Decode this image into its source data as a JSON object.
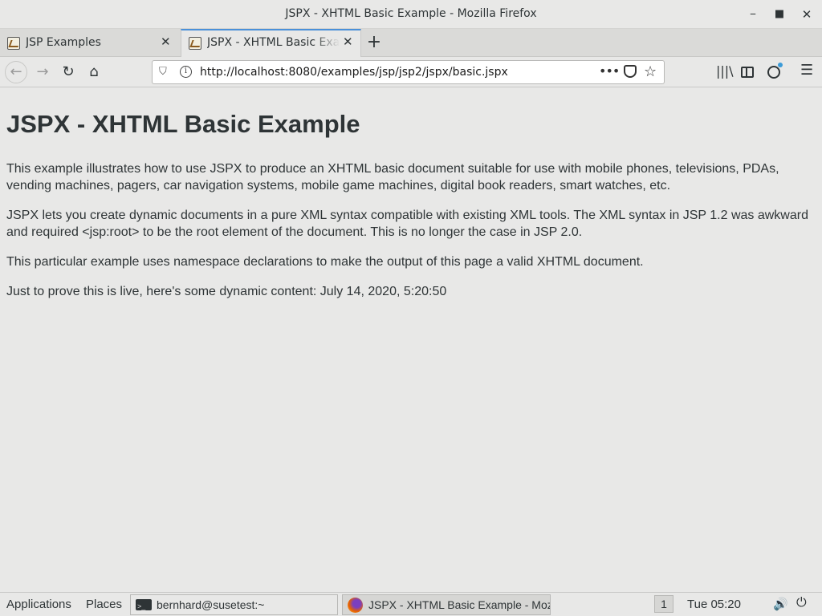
{
  "window": {
    "title": "JSPX - XHTML Basic Example - Mozilla Firefox",
    "minimize_glyph": "⎯",
    "maximize_glyph": "■",
    "close_glyph": "✕"
  },
  "tabs": [
    {
      "label": "JSP Examples",
      "close_glyph": "✕",
      "active": false
    },
    {
      "label": "JSPX - XHTML Basic Example",
      "close_glyph": "✕",
      "active": true
    }
  ],
  "new_tab_glyph": "+",
  "nav": {
    "back_glyph": "←",
    "forward_glyph": "→",
    "reload_glyph": "↻",
    "home_glyph": "⌂",
    "url": "http://localhost:8080/examples/jsp/jsp2/jspx/basic.jspx",
    "shield_glyph": "⛉",
    "info_glyph": "i",
    "more_glyph": "•••",
    "star_glyph": "☆",
    "library_glyph": "|||\\",
    "menu_glyph": "☰"
  },
  "page": {
    "heading": "JSPX - XHTML Basic Example",
    "paragraphs": [
      "This example illustrates how to use JSPX to produce an XHTML basic document suitable for use with mobile phones, televisions, PDAs, vending machines, pagers, car navigation systems, mobile game machines, digital book readers, smart watches, etc.",
      "JSPX lets you create dynamic documents in a pure XML syntax compatible with existing XML tools. The XML syntax in JSP 1.2 was awkward and required <jsp:root> to be the root element of the document. This is no longer the case in JSP 2.0.",
      "This particular example uses namespace declarations to make the output of this page a valid XHTML document.",
      "Just to prove this is live, here's some dynamic content: July 14, 2020, 5:20:50"
    ]
  },
  "taskbar": {
    "applications": "Applications",
    "places": "Places",
    "windows": [
      {
        "label": "bernhard@susetest:~",
        "icon": "terminal-icon"
      },
      {
        "label": "JSPX - XHTML Basic Example - Moz...",
        "icon": "firefox-icon"
      }
    ],
    "workspace": "1",
    "clock": "Tue 05:20",
    "volume_glyph": "🔊",
    "power_glyph": "⏻"
  },
  "colors": {
    "background": "#e8e8e7",
    "text": "#2e3436",
    "active_tab_accent": "#4a90d9"
  }
}
